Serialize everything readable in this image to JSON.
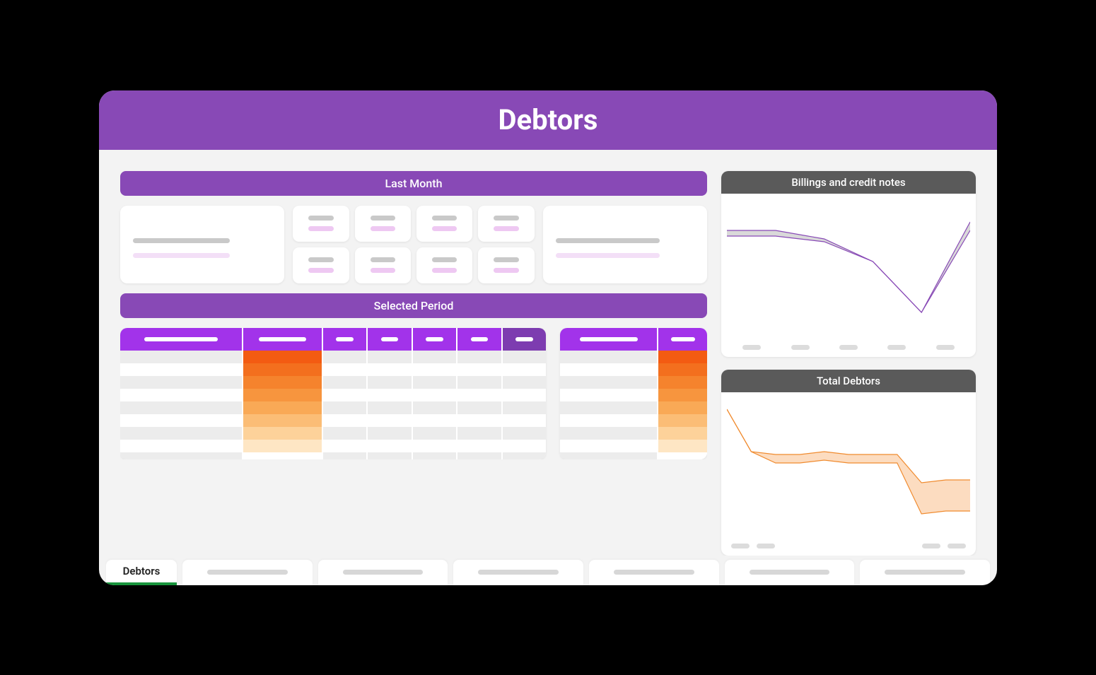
{
  "title": "Debtors",
  "sections": {
    "last_month": "Last Month",
    "selected_period": "Selected Period"
  },
  "tabs": {
    "active": "Debtors"
  },
  "charts": {
    "billings": {
      "title": "Billings and credit notes"
    },
    "total_debtors": {
      "title": "Total Debtors"
    }
  },
  "chart_data": [
    {
      "id": "billings",
      "type": "area",
      "title": "Billings and credit notes",
      "x": [
        0,
        1,
        2,
        3,
        4,
        5
      ],
      "series": [
        {
          "name": "upper",
          "values": [
            78,
            78,
            72,
            56,
            20,
            84
          ],
          "color": "#8849b6"
        },
        {
          "name": "lower",
          "values": [
            74,
            74,
            70,
            56,
            20,
            78
          ],
          "color": "#8849b6"
        }
      ],
      "ylim": [
        0,
        100
      ],
      "labels_placeholder_count": 5
    },
    {
      "id": "total_debtors",
      "type": "area",
      "title": "Total Debtors",
      "x": [
        0,
        1,
        2,
        3,
        4,
        5,
        6,
        7,
        8,
        9,
        10
      ],
      "series": [
        {
          "name": "upper",
          "values": [
            92,
            62,
            60,
            60,
            62,
            60,
            60,
            60,
            40,
            42,
            42
          ],
          "color": "#f08b2f"
        },
        {
          "name": "lower",
          "values": [
            92,
            62,
            54,
            54,
            56,
            54,
            54,
            54,
            18,
            20,
            20
          ],
          "color": "#f08b2f"
        }
      ],
      "ylim": [
        0,
        100
      ],
      "labels_placeholder_count": 4
    }
  ],
  "heat_colors": [
    "#f35b12",
    "#f36f1e",
    "#f5832d",
    "#f7953e",
    "#f9a956",
    "#fbbd76",
    "#fdd29a",
    "#fee6c4",
    "#ffffff"
  ],
  "table_rows": 9,
  "accent": {
    "purple": "#8849b6",
    "violet": "#a233ea",
    "green": "#17933b",
    "gray_header": "#5a5a5a",
    "orange": "#f08b2f"
  }
}
